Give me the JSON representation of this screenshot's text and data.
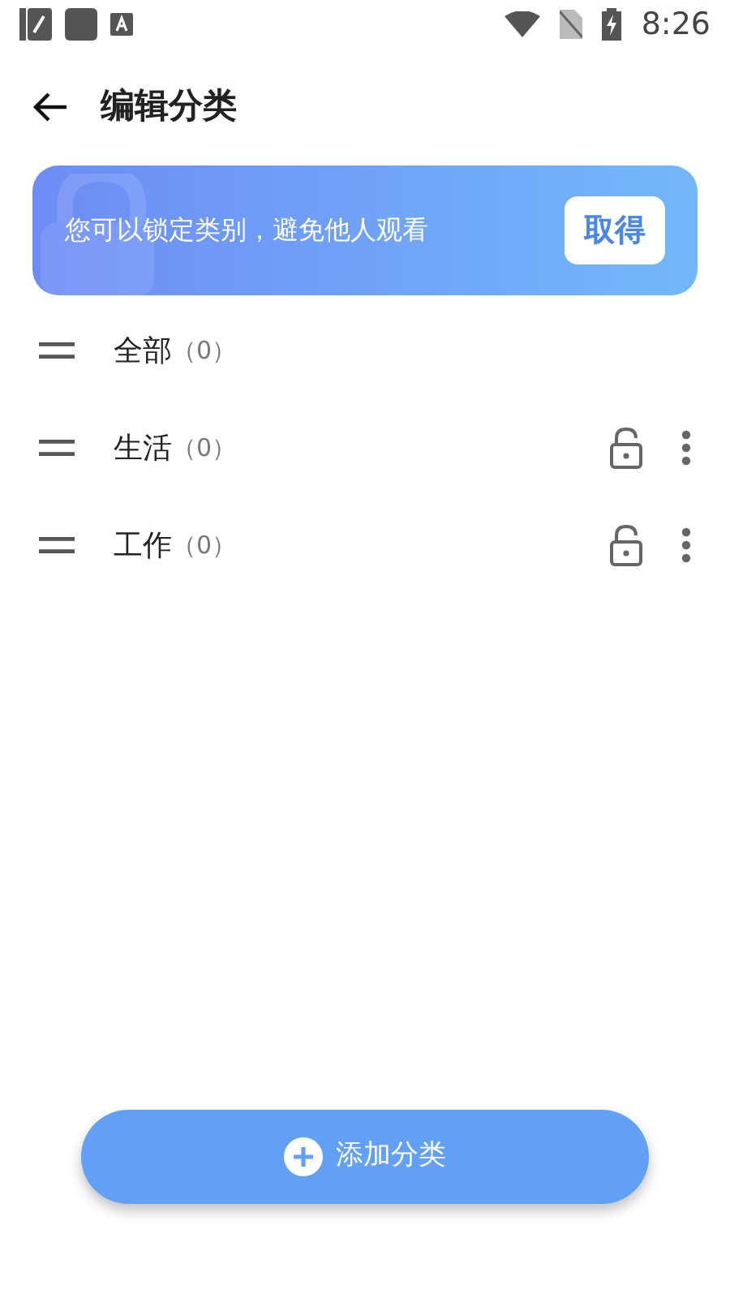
{
  "status_bar": {
    "time": "8:26"
  },
  "header": {
    "title": "编辑分类"
  },
  "banner": {
    "text": "您可以锁定类别，避免他人观看",
    "button": "取得"
  },
  "categories": [
    {
      "kind": "fixed",
      "name": "全部",
      "count": "（0）"
    },
    {
      "kind": "custom",
      "name": "生活",
      "count": "（0）"
    },
    {
      "kind": "custom",
      "name": "工作",
      "count": "（0）"
    }
  ],
  "add_button": {
    "label": "添加分类"
  }
}
